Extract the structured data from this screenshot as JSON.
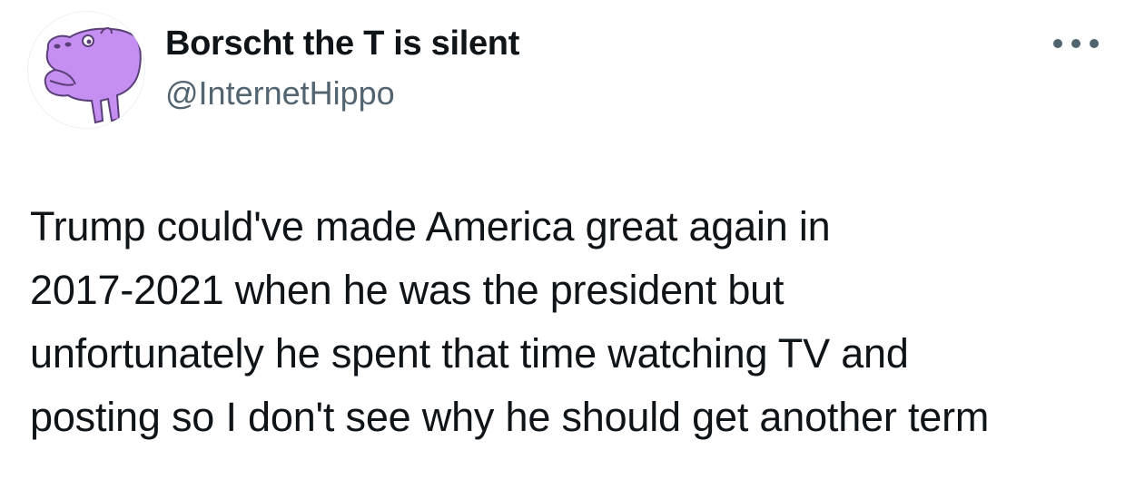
{
  "tweet": {
    "author": {
      "display_name": "Borscht the T is silent",
      "handle": "@InternetHippo",
      "avatar": "purple-hippo-cartoon-avatar",
      "avatar_color": "#c58ff2"
    },
    "more_icon": "more-horizontal-icon",
    "text_lines": [
      "Trump could've made America great again in",
      "2017-2021 when he was the president but",
      "unfortunately he spent that time watching TV and",
      "posting so I don't see why he should get another term"
    ]
  }
}
